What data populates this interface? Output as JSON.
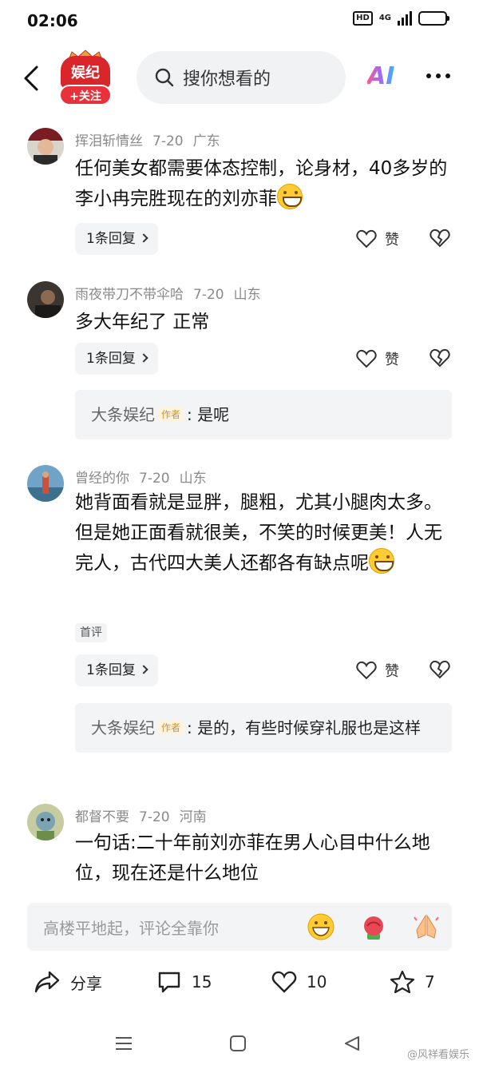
{
  "status_bar": {
    "time": "02:06",
    "hd": "HD",
    "network": "4G"
  },
  "nav": {
    "follow_label": "+关注",
    "logo_text": "娱纪",
    "search_placeholder": "搜你想看的",
    "ai_label": "AI"
  },
  "comments": [
    {
      "username": "挥泪斩情丝",
      "date": "7-20",
      "location": "广东",
      "text": "任何美女都需要体态控制，论身材，40多岁的李小冉完胜现在的刘亦菲",
      "has_emoji": true,
      "replies_label": "1条回复",
      "like_label": "赞"
    },
    {
      "username": "雨夜带刀不带伞哈",
      "date": "7-20",
      "location": "山东",
      "text": "多大年纪了 正常",
      "replies_label": "1条回复",
      "like_label": "赞",
      "reply": {
        "author": "大条娱纪",
        "author_tag": "作者",
        "text": ": 是呢"
      }
    },
    {
      "username": "曾经的你",
      "date": "7-20",
      "location": "山东",
      "text": "她背面看就是显胖，腿粗，尤其小腿肉太多。但是她正面看就很美，不笑的时候更美！人无完人，古代四大美人还都各有缺点呢",
      "has_emoji": true,
      "tag": "首评",
      "replies_label": "1条回复",
      "like_label": "赞",
      "reply": {
        "author": "大条娱纪",
        "author_tag": "作者",
        "text": ": 是的，有些时候穿礼服也是这样"
      }
    },
    {
      "username": "都督不要",
      "date": "7-20",
      "location": "河南",
      "text": "一句话:二十年前刘亦菲在男人心目中什么地位，现在还是什么地位"
    }
  ],
  "input_bar": {
    "placeholder": "高楼平地起，评论全靠你"
  },
  "actions": {
    "share_label": "分享",
    "comments_count": "15",
    "likes_count": "10",
    "favorites_count": "7"
  },
  "watermark": "@风祥看娱乐",
  "colors": {
    "accent_red": "#e8313a",
    "meta_gray": "#8a8a8a",
    "bubble_bg": "#f3f4f6",
    "author_tag": "#d2932b"
  }
}
